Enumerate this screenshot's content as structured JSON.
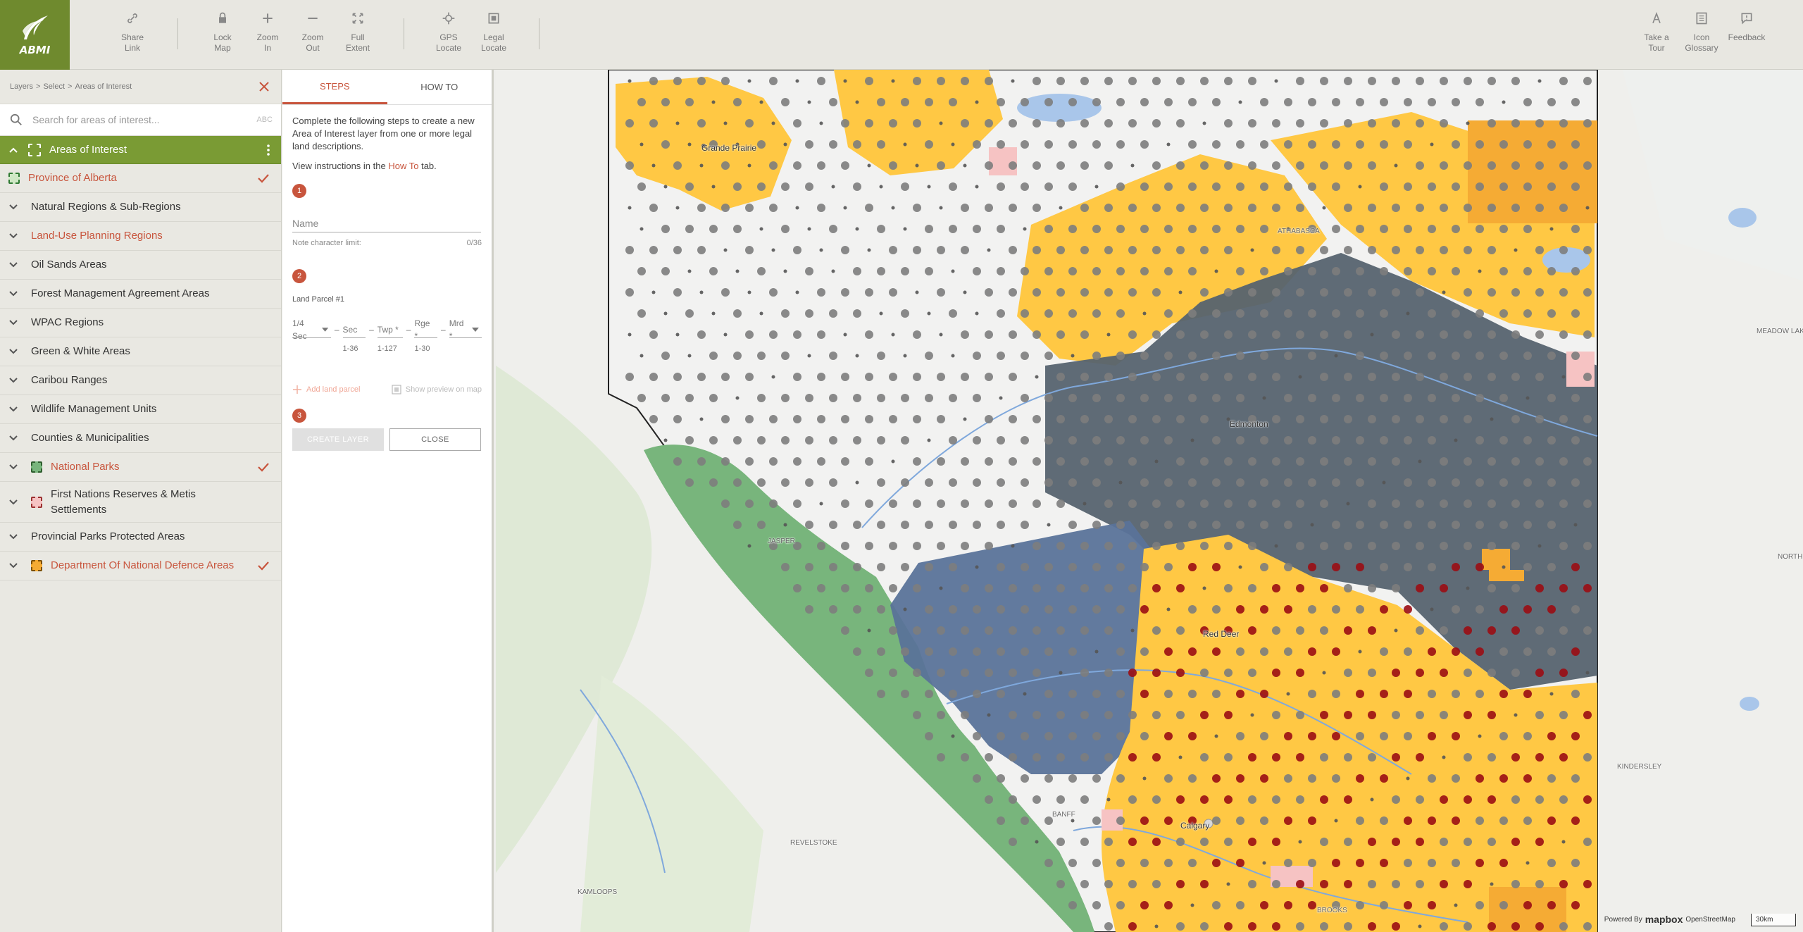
{
  "toolbar": {
    "logo": "ABMI",
    "buttons": [
      {
        "id": "share",
        "label": "Share\nLink",
        "icon": "link-icon"
      },
      {
        "id": "lock",
        "label": "Lock\nMap",
        "icon": "lock-icon"
      },
      {
        "id": "zoomin",
        "label": "Zoom\nIn",
        "icon": "plus-icon"
      },
      {
        "id": "zoomout",
        "label": "Zoom\nOut",
        "icon": "minus-icon"
      },
      {
        "id": "full",
        "label": "Full\nExtent",
        "icon": "expand-icon"
      },
      {
        "id": "gps",
        "label": "GPS\nLocate",
        "icon": "crosshair-icon"
      },
      {
        "id": "legal",
        "label": "Legal\nLocate",
        "icon": "square-icon"
      },
      {
        "id": "tour",
        "label": "Take a\nTour",
        "icon": "tour-icon"
      },
      {
        "id": "glossary",
        "label": "Icon\nGlossary",
        "icon": "list-icon"
      },
      {
        "id": "feedback",
        "label": "Feedback",
        "icon": "feedback-icon"
      }
    ]
  },
  "breadcrumb": {
    "items": [
      "Layers",
      "Select",
      "Areas of Interest"
    ],
    "separator": ">"
  },
  "search": {
    "placeholder": "Search for areas of interest...",
    "sort_label": "ABC"
  },
  "aoi_header": {
    "label": "Areas of Interest"
  },
  "layers": [
    {
      "label": "Province of Alberta",
      "active": true,
      "checked": true,
      "swatch": "green-dashed"
    },
    {
      "label": "Natural Regions & Sub-Regions",
      "active": false,
      "checked": false
    },
    {
      "label": "Land-Use Planning Regions",
      "active": true,
      "checked": false
    },
    {
      "label": "Oil Sands Areas",
      "active": false,
      "checked": false
    },
    {
      "label": "Forest Management Agreement Areas",
      "active": false,
      "checked": false
    },
    {
      "label": "WPAC Regions",
      "active": false,
      "checked": false
    },
    {
      "label": "Green & White Areas",
      "active": false,
      "checked": false
    },
    {
      "label": "Caribou Ranges",
      "active": false,
      "checked": false
    },
    {
      "label": "Wildlife Management Units",
      "active": false,
      "checked": false
    },
    {
      "label": "Counties & Municipalities",
      "active": false,
      "checked": false
    },
    {
      "label": "National Parks",
      "active": true,
      "checked": true,
      "swatch": "green-fill"
    },
    {
      "label": "First Nations Reserves & Metis Settlements",
      "active": false,
      "checked": false,
      "swatch": "pink-fill"
    },
    {
      "label": "Provincial Parks Protected Areas",
      "active": false,
      "checked": false
    },
    {
      "label": "Department Of National Defence Areas",
      "active": true,
      "checked": true,
      "swatch": "orange-fill"
    }
  ],
  "steps_panel": {
    "tabs": [
      "STEPS",
      "HOW TO"
    ],
    "active_tab": "STEPS",
    "intro": "Complete the following steps to create a new Area of Interest layer from one or more legal land descriptions.",
    "view_prefix": "View instructions in the ",
    "view_link": "How To",
    "view_suffix": " tab.",
    "step_numbers": [
      "1",
      "2",
      "3"
    ],
    "name_placeholder": "Name",
    "name_hint": "Note character limit:",
    "name_count": "0/36",
    "parcel_title": "Land Parcel #1",
    "parcel_fields": [
      {
        "label": "1/4 Sec",
        "dropdown": true,
        "hint": ""
      },
      {
        "label": "Sec",
        "dropdown": false,
        "hint": "1-36"
      },
      {
        "label": "Twp *",
        "dropdown": false,
        "hint": "1-127"
      },
      {
        "label": "Rge *",
        "dropdown": false,
        "hint": "1-30"
      },
      {
        "label": "Mrd *",
        "dropdown": true,
        "hint": ""
      }
    ],
    "add_parcel": "Add land parcel",
    "show_preview": "Show preview on map",
    "create_btn": "CREATE LAYER",
    "close_btn": "CLOSE"
  },
  "map": {
    "labels": [
      {
        "text": "Grande Prairie"
      },
      {
        "text": "ATHABASCA"
      },
      {
        "text": "Edmonton"
      },
      {
        "text": "Red Deer"
      },
      {
        "text": "Calgary"
      },
      {
        "text": "REVELSTOKE"
      },
      {
        "text": "KAMLOOPS"
      },
      {
        "text": "MEADOW LAKE"
      },
      {
        "text": "NORTH BA"
      },
      {
        "text": "KINDERSLEY"
      },
      {
        "text": "BROOKS"
      },
      {
        "text": "JASPER"
      },
      {
        "text": "BANFF"
      }
    ],
    "attribution_prefix": "Powered By",
    "attribution_brand": "mapbox",
    "attribution_suffix": "OpenStreetMap",
    "scale": "30km",
    "colors": {
      "yellow": "#ffc844",
      "grey_blue": "#56636f",
      "blue": "#5a7399",
      "green": "#78b57c",
      "dark_red": "#9b0d14",
      "grey_dot": "#7d7d7d",
      "orange": "#f5ab34",
      "pink": "#f6c3c3"
    }
  }
}
